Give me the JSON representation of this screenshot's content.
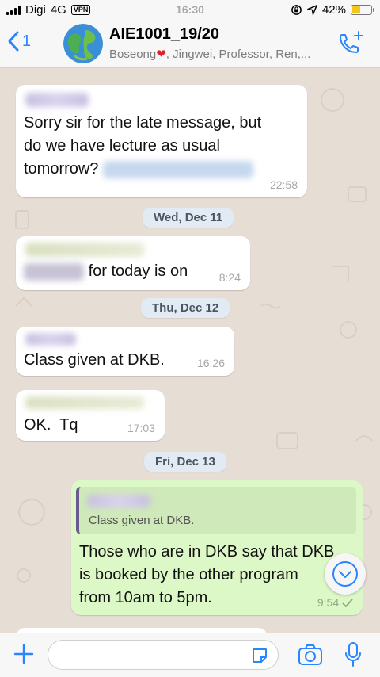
{
  "status": {
    "carrier": "Digi",
    "network": "4G",
    "vpn": "VPN",
    "time": "16:30",
    "battery": "42%"
  },
  "header": {
    "back_count": "1",
    "title": "AIE1001_19/20",
    "subtitle_name1": "Boseong",
    "subtitle_rest": ", Jingwei, Professor, Ren,..."
  },
  "messages": [
    {
      "lines": [
        "Sorry sir for the late message, but",
        "do we have lecture as usual",
        "tomorrow?"
      ],
      "time": "22:58"
    },
    {
      "date": "Wed, Dec 11"
    },
    {
      "text": "for today is on",
      "time": "8:24"
    },
    {
      "date": "Thu, Dec 12"
    },
    {
      "text": "Class given at DKB.",
      "time": "16:26"
    },
    {
      "text": "OK.  Tq",
      "time": "17:03"
    },
    {
      "date": "Fri, Dec 13"
    },
    {
      "quote": "Class given at DKB.",
      "lines": [
        "Those who are in DKB say that DKB",
        "is booked by the other program",
        "from 10am to 5pm."
      ],
      "time": "9:54",
      "status": "sent"
    }
  ],
  "colors": {
    "accent": "#2a86ff",
    "outgoing_bubble": "#dcf8c6",
    "incoming_bubble": "#ffffff",
    "chat_background": "#e6ddd4"
  }
}
